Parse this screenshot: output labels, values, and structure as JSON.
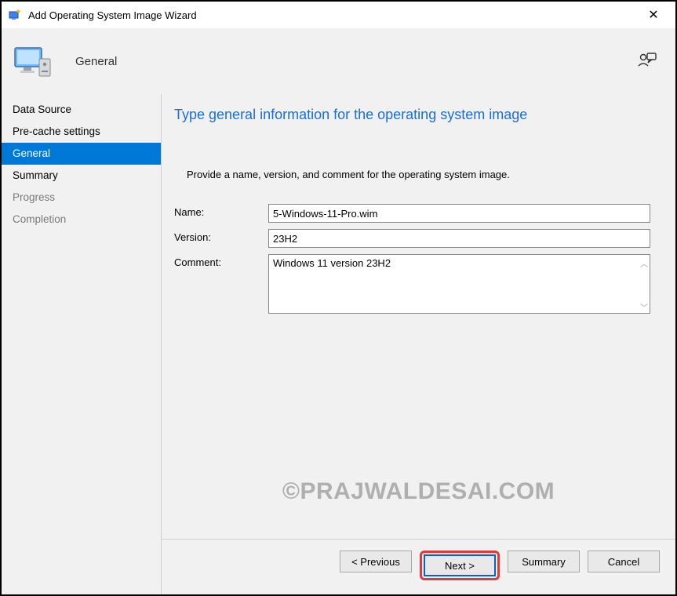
{
  "window": {
    "title": "Add Operating System Image Wizard",
    "close_glyph": "✕"
  },
  "header": {
    "title": "General"
  },
  "sidebar": {
    "items": [
      {
        "label": "Data Source",
        "active": false,
        "dim": false
      },
      {
        "label": "Pre-cache settings",
        "active": false,
        "dim": false
      },
      {
        "label": "General",
        "active": true,
        "dim": false
      },
      {
        "label": "Summary",
        "active": false,
        "dim": false
      },
      {
        "label": "Progress",
        "active": false,
        "dim": true
      },
      {
        "label": "Completion",
        "active": false,
        "dim": true
      }
    ]
  },
  "main": {
    "heading": "Type general information for the operating system image",
    "subtext": "Provide a name, version, and comment for the operating system image.",
    "fields": {
      "name_label": "Name:",
      "name_value": "5-Windows-11-Pro.wim",
      "version_label": "Version:",
      "version_value": "23H2",
      "comment_label": "Comment:",
      "comment_value": "Windows 11 version 23H2"
    }
  },
  "footer": {
    "previous": "< Previous",
    "next": "Next >",
    "summary": "Summary",
    "cancel": "Cancel"
  },
  "watermark": "©PRAJWALDESAI.COM"
}
